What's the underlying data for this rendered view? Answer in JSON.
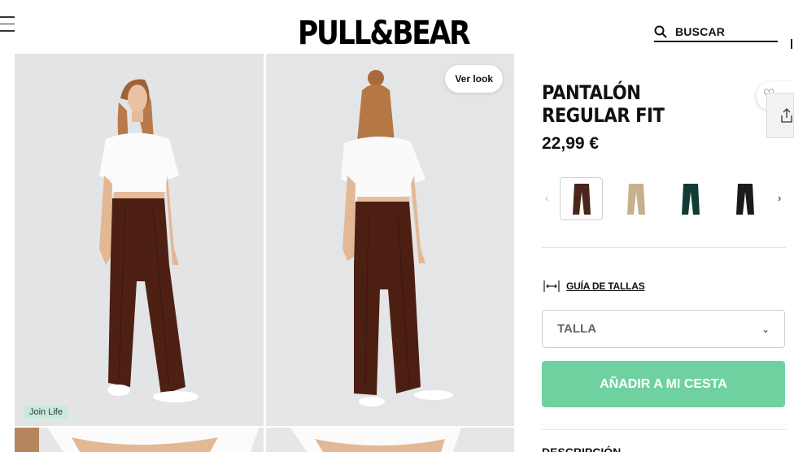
{
  "header": {
    "brand": "PULL&BEAR",
    "search_label": "BUSCAR"
  },
  "gallery": {
    "badge": "Join Life",
    "look_button": "Ver look"
  },
  "product": {
    "title": "PANTALÓN REGULAR FIT",
    "price": "22,99 €",
    "colors": [
      {
        "name": "brown",
        "hex": "#4a2519",
        "selected": true
      },
      {
        "name": "beige",
        "hex": "#c8b08c",
        "selected": false
      },
      {
        "name": "dark green",
        "hex": "#123b36",
        "selected": false
      },
      {
        "name": "black",
        "hex": "#1b1b1b",
        "selected": false
      }
    ],
    "size_guide": "GUÍA DE TALLAS",
    "size_placeholder": "TALLA",
    "add_to_cart": "AÑADIR A MI CESTA",
    "next_section": "DESCRIPCIÓN"
  },
  "colors": {
    "accent": "#6fd1a0",
    "badge_bg": "#c9ead8"
  }
}
